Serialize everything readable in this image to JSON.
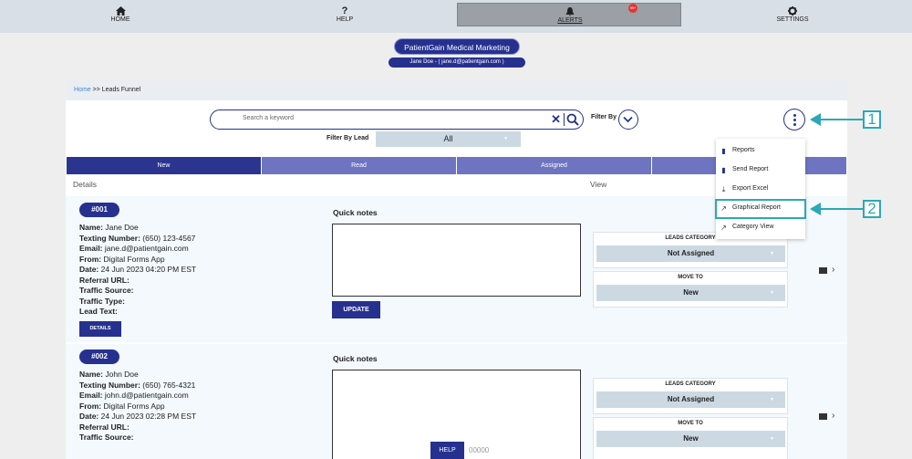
{
  "nav": {
    "home_label": "HOME",
    "help_label": "HELP",
    "alerts_label": "ALERTS",
    "alerts_badge": "99+",
    "settings_label": "SETTINGS",
    "home_icon": "home-icon",
    "help_icon": "?",
    "alerts_icon": "bell-icon",
    "settings_icon": "gear-icon"
  },
  "brand": {
    "title": "PatientGain Medical Marketing",
    "user": "Jane Doe - ( jane.d@patientgain.com )"
  },
  "breadcrumb": {
    "home": "Home",
    "separator": " >> ",
    "current": "Leads Funnel"
  },
  "search": {
    "placeholder": "Search a keyword",
    "filter_by_label": "Filter By"
  },
  "filter_lead": {
    "label": "Filter By Lead",
    "value": "All"
  },
  "tabs": [
    "New",
    "Read",
    "Assigned",
    ""
  ],
  "headers": {
    "details": "Details",
    "view": "View"
  },
  "menu": {
    "items": [
      "Reports",
      "Send Report",
      "Export Excel",
      "Graphical Report",
      "Category View"
    ]
  },
  "annotations": [
    "1",
    "2"
  ],
  "leads": [
    {
      "id": "#001",
      "name": "Jane Doe",
      "texting_number": "(650) 123-4567",
      "email": "jane.d@patientgain.com",
      "from": "Digital Forms App",
      "date": "24 Jun 2023 04:20 PM EST",
      "details_button": "DETAILS",
      "quick_notes_label": "Quick notes",
      "update_button": "UPDATE",
      "leads_category_label": "LEADS CATEGORY",
      "leads_category_value": "Not Assigned",
      "move_to_label": "MOVE TO",
      "move_to_value": "New"
    },
    {
      "id": "#002",
      "name": "John Doe",
      "texting_number": "(650) 765-4321",
      "email": "john.d@patientgain.com",
      "from": "Digital Forms App",
      "date": "24 Jun 2023 02:28 PM EST",
      "quick_notes_label": "Quick notes",
      "leads_category_label": "LEADS CATEGORY",
      "leads_category_value": "Not Assigned",
      "move_to_label": "MOVE TO",
      "move_to_value": "New"
    }
  ],
  "field_labels": {
    "name": "Name:",
    "texting": "Texting Number:",
    "email": "Email:",
    "from": "From:",
    "date": "Date:",
    "referral": "Referral URL:",
    "traffic_source": "Traffic Source:",
    "traffic_type": "Traffic Type:",
    "lead_text": "Lead Text:"
  },
  "footer": {
    "help_button": "HELP",
    "counter": "00000"
  },
  "colors": {
    "primary": "#26318f",
    "tab_inactive": "#6e74c0",
    "annotation": "#2aa9b6",
    "select_bg": "#ccd9e3"
  }
}
